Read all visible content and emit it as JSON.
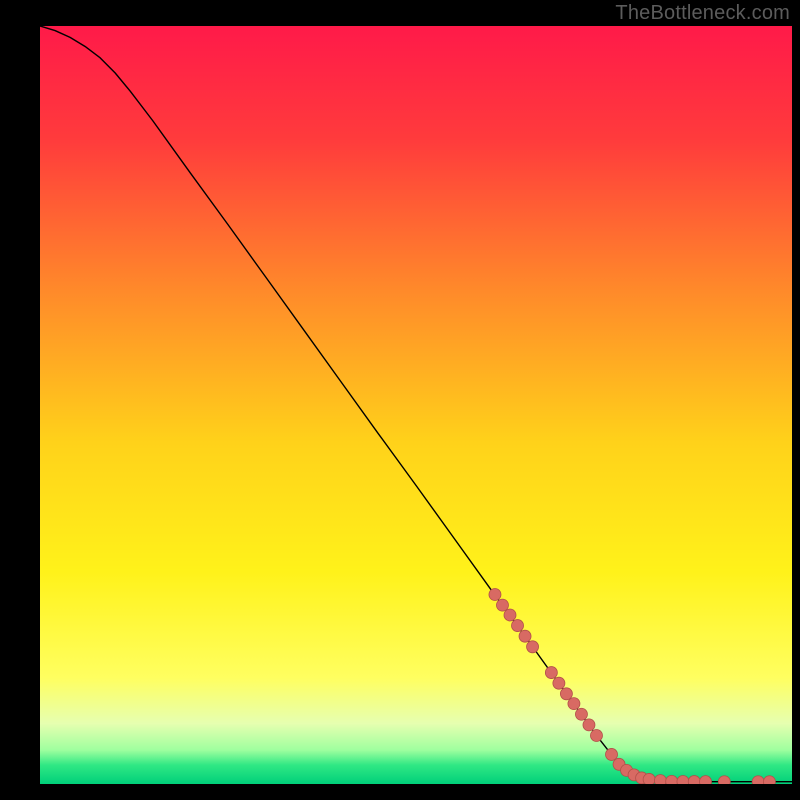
{
  "attribution": "TheBottleneck.com",
  "chart_data": {
    "type": "line",
    "title": "",
    "xlabel": "",
    "ylabel": "",
    "xlim": [
      0,
      100
    ],
    "ylim": [
      0,
      100
    ],
    "grid": false,
    "background_gradient": {
      "stops": [
        {
          "pos": 0.0,
          "color": "#ff1a49"
        },
        {
          "pos": 0.15,
          "color": "#ff3b3c"
        },
        {
          "pos": 0.35,
          "color": "#ff8a2a"
        },
        {
          "pos": 0.55,
          "color": "#ffd21a"
        },
        {
          "pos": 0.72,
          "color": "#fff21a"
        },
        {
          "pos": 0.86,
          "color": "#ffff60"
        },
        {
          "pos": 0.92,
          "color": "#e6ffb0"
        },
        {
          "pos": 0.955,
          "color": "#9fff9f"
        },
        {
          "pos": 0.975,
          "color": "#30e884"
        },
        {
          "pos": 1.0,
          "color": "#00cf7a"
        }
      ]
    },
    "series": [
      {
        "name": "bottleneck-curve",
        "color": "#000000",
        "width": 1.4,
        "points": [
          {
            "x": 0,
            "y": 100.0
          },
          {
            "x": 2,
            "y": 99.4
          },
          {
            "x": 4,
            "y": 98.5
          },
          {
            "x": 6,
            "y": 97.3
          },
          {
            "x": 8,
            "y": 95.8
          },
          {
            "x": 10,
            "y": 93.8
          },
          {
            "x": 12,
            "y": 91.4
          },
          {
            "x": 15,
            "y": 87.5
          },
          {
            "x": 20,
            "y": 80.6
          },
          {
            "x": 25,
            "y": 73.8
          },
          {
            "x": 30,
            "y": 66.9
          },
          {
            "x": 35,
            "y": 60.0
          },
          {
            "x": 40,
            "y": 53.1
          },
          {
            "x": 45,
            "y": 46.2
          },
          {
            "x": 50,
            "y": 39.4
          },
          {
            "x": 55,
            "y": 32.5
          },
          {
            "x": 60,
            "y": 25.6
          },
          {
            "x": 65,
            "y": 18.8
          },
          {
            "x": 70,
            "y": 11.9
          },
          {
            "x": 74,
            "y": 6.4
          },
          {
            "x": 77,
            "y": 2.6
          },
          {
            "x": 79,
            "y": 1.2
          },
          {
            "x": 81,
            "y": 0.6
          },
          {
            "x": 84,
            "y": 0.35
          },
          {
            "x": 88,
            "y": 0.3
          },
          {
            "x": 92,
            "y": 0.3
          },
          {
            "x": 96,
            "y": 0.3
          },
          {
            "x": 100,
            "y": 0.3
          }
        ]
      }
    ],
    "markers": {
      "color": "#d86a63",
      "stroke": "#b24f49",
      "radius": 6,
      "points": [
        {
          "x": 60.5,
          "y": 25.0
        },
        {
          "x": 61.5,
          "y": 23.6
        },
        {
          "x": 62.5,
          "y": 22.3
        },
        {
          "x": 63.5,
          "y": 20.9
        },
        {
          "x": 64.5,
          "y": 19.5
        },
        {
          "x": 65.5,
          "y": 18.1
        },
        {
          "x": 68.0,
          "y": 14.7
        },
        {
          "x": 69.0,
          "y": 13.3
        },
        {
          "x": 70.0,
          "y": 11.9
        },
        {
          "x": 71.0,
          "y": 10.6
        },
        {
          "x": 72.0,
          "y": 9.2
        },
        {
          "x": 73.0,
          "y": 7.8
        },
        {
          "x": 74.0,
          "y": 6.4
        },
        {
          "x": 76.0,
          "y": 3.9
        },
        {
          "x": 77.0,
          "y": 2.6
        },
        {
          "x": 78.0,
          "y": 1.8
        },
        {
          "x": 79.0,
          "y": 1.2
        },
        {
          "x": 80.0,
          "y": 0.8
        },
        {
          "x": 81.0,
          "y": 0.6
        },
        {
          "x": 82.5,
          "y": 0.45
        },
        {
          "x": 84.0,
          "y": 0.35
        },
        {
          "x": 85.5,
          "y": 0.33
        },
        {
          "x": 87.0,
          "y": 0.32
        },
        {
          "x": 88.5,
          "y": 0.31
        },
        {
          "x": 91.0,
          "y": 0.3
        },
        {
          "x": 95.5,
          "y": 0.3
        },
        {
          "x": 97.0,
          "y": 0.3
        }
      ]
    }
  }
}
